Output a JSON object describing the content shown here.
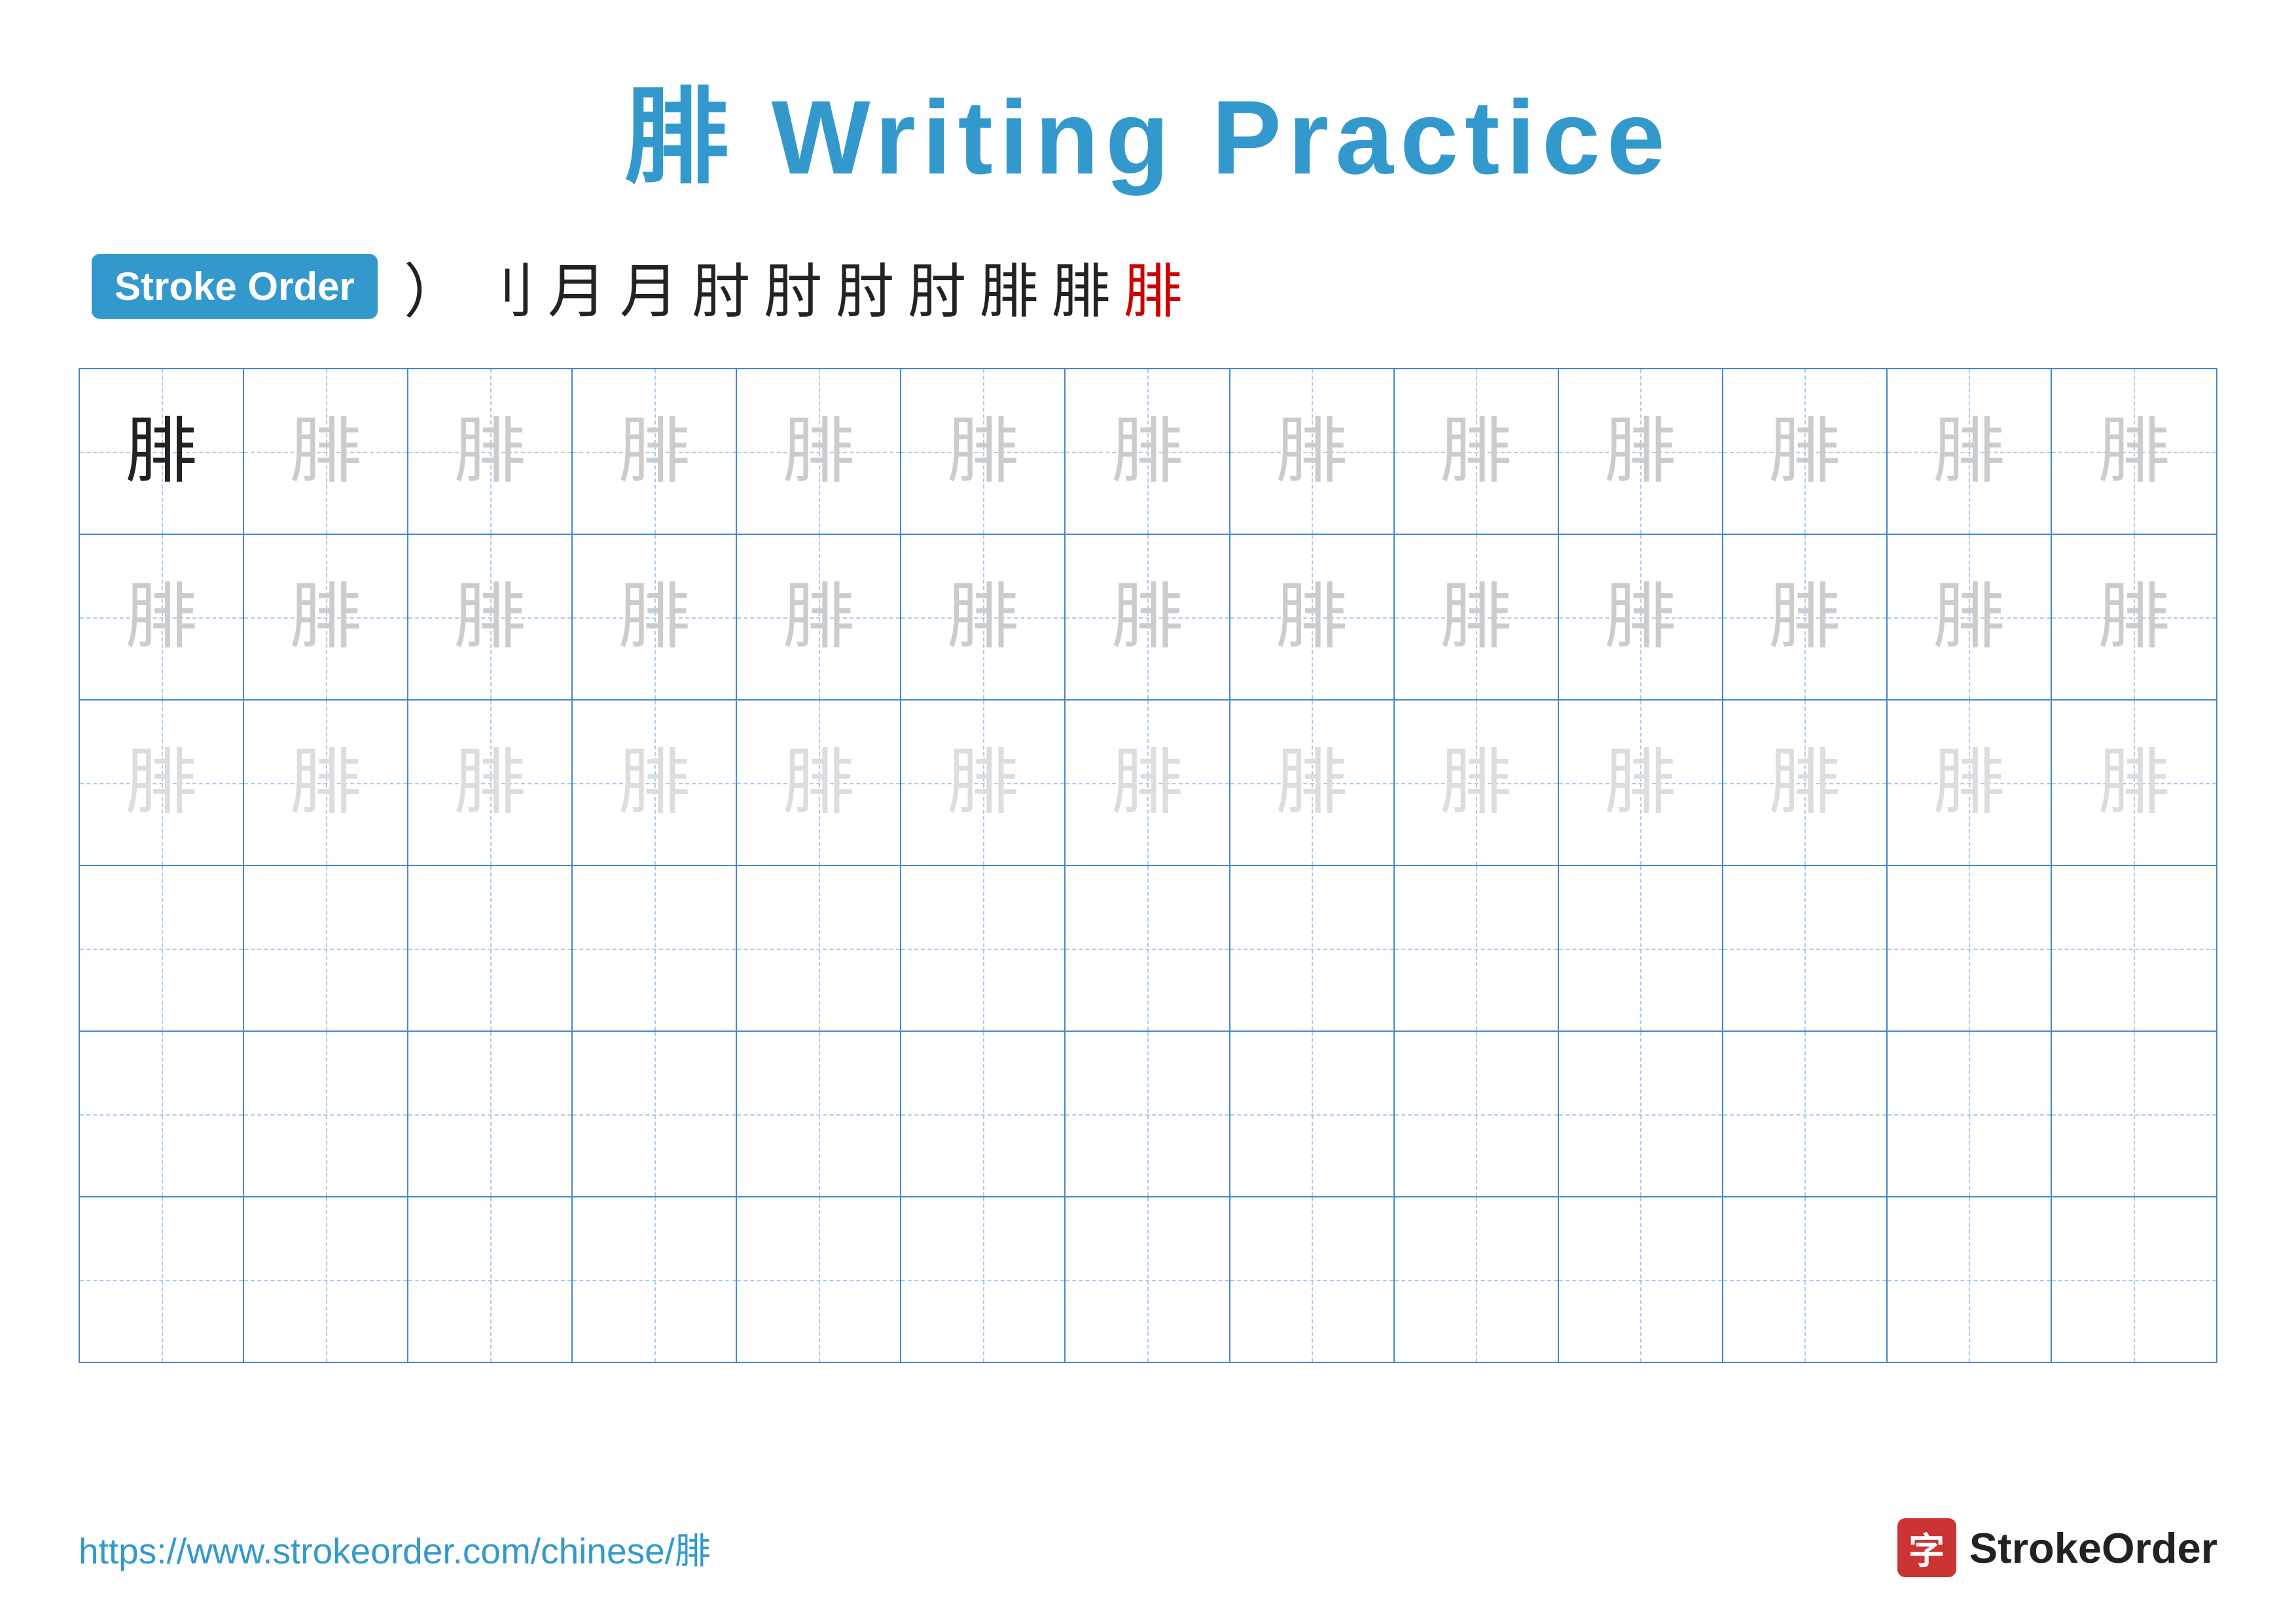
{
  "title": {
    "text": "腓 Writing Practice",
    "char": "腓"
  },
  "stroke_order": {
    "badge_label": "Stroke Order",
    "strokes": [
      ")",
      "刂",
      "月",
      "月",
      "肘",
      "肘",
      "肘",
      "肘",
      "腓",
      "腓",
      "腓"
    ]
  },
  "grid": {
    "character": "腓",
    "rows": 6,
    "cols": 13,
    "row_styles": [
      "dark-first",
      "light1",
      "light2",
      "empty",
      "empty",
      "empty"
    ]
  },
  "footer": {
    "url": "https://www.strokeorder.com/chinese/腓",
    "logo_char": "字",
    "logo_text": "StrokeOrder"
  }
}
